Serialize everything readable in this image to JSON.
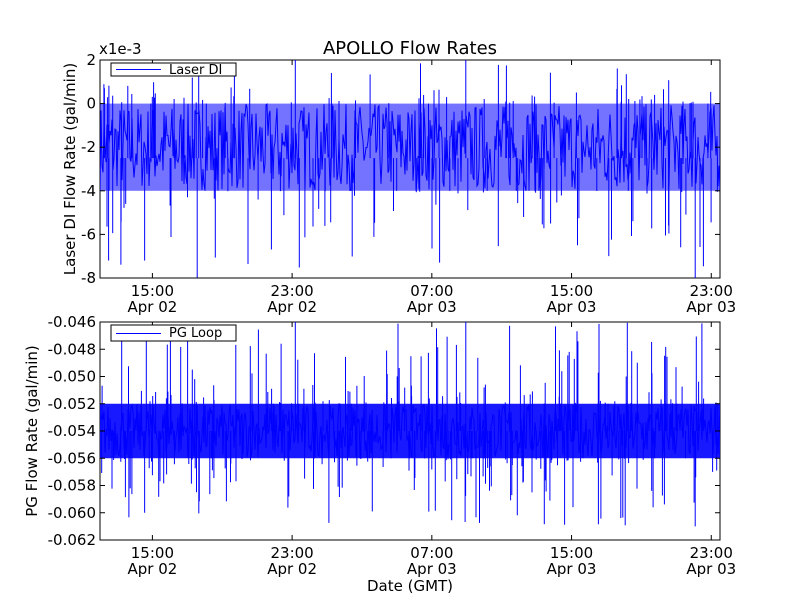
{
  "figure": {
    "title": "APOLLO Flow Rates",
    "xlabel": "Date (GMT)",
    "line_color": "#0000ff"
  },
  "chart_data": [
    {
      "type": "line",
      "title": "APOLLO Flow Rates",
      "ylabel": "Laser DI Flow Rate (gal/min)",
      "y_scale_label": "x1e-3",
      "legend": "top-left",
      "grid": false,
      "ylim": [
        -8,
        2
      ],
      "yticks": [
        "2",
        "0",
        "-2",
        "-4",
        "-6",
        "-8"
      ],
      "x_range": [
        "2014-04-02T12:00",
        "2014-04-03T23:30"
      ],
      "xticks": [
        {
          "time": "15:00",
          "date": "Apr 02"
        },
        {
          "time": "23:00",
          "date": "Apr 02"
        },
        {
          "time": "07:00",
          "date": "Apr 03"
        },
        {
          "time": "15:00",
          "date": "Apr 03"
        },
        {
          "time": "23:00",
          "date": "Apr 03"
        }
      ],
      "series": [
        {
          "name": "Laser DI",
          "baseline": -2.5,
          "typical_range": [
            -4,
            0
          ],
          "min": -8,
          "max": 2
        }
      ]
    },
    {
      "type": "line",
      "ylabel": "PG Flow Rate (gal/min)",
      "legend": "top-left",
      "grid": false,
      "ylim": [
        -0.062,
        -0.046
      ],
      "yticks": [
        "-0.046",
        "-0.048",
        "-0.050",
        "-0.052",
        "-0.054",
        "-0.056",
        "-0.058",
        "-0.060",
        "-0.062"
      ],
      "x_range": [
        "2014-04-02T12:00",
        "2014-04-03T23:30"
      ],
      "xticks": [
        {
          "time": "15:00",
          "date": "Apr 02"
        },
        {
          "time": "23:00",
          "date": "Apr 02"
        },
        {
          "time": "07:00",
          "date": "Apr 03"
        },
        {
          "time": "15:00",
          "date": "Apr 03"
        },
        {
          "time": "23:00",
          "date": "Apr 03"
        }
      ],
      "series": [
        {
          "name": "PG Loop",
          "baseline": -0.054,
          "typical_range": [
            -0.056,
            -0.052
          ],
          "min": -0.061,
          "max": -0.046
        }
      ]
    }
  ]
}
